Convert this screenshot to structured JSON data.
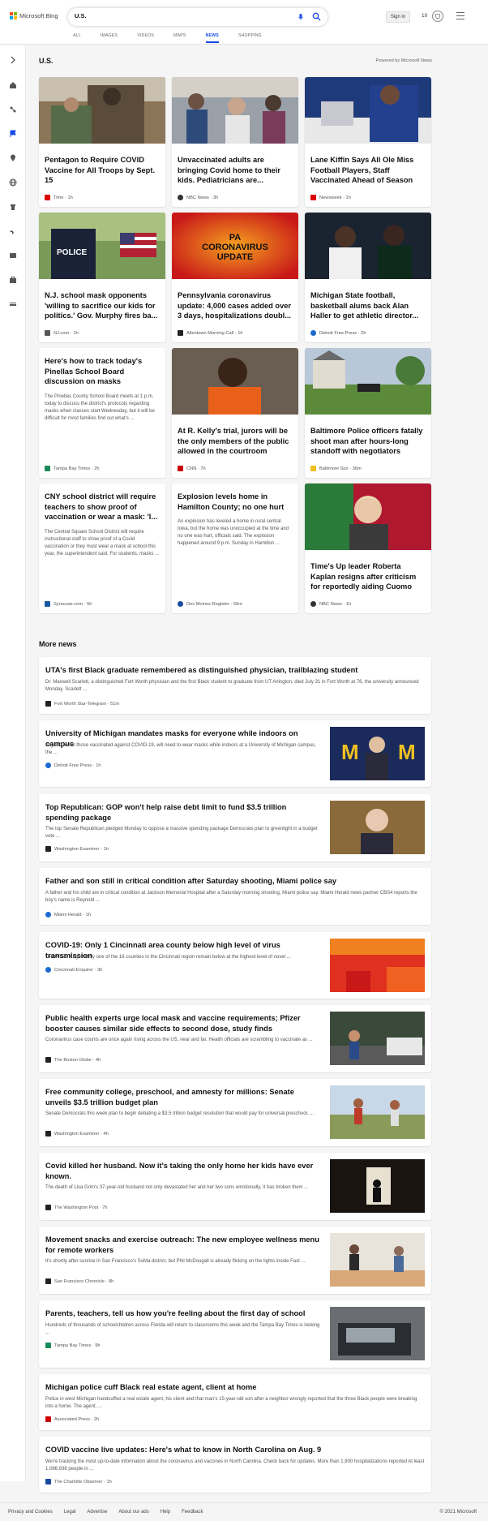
{
  "header": {
    "brand": "Microsoft Bing",
    "search_value": "U.S.",
    "signin_label": "Sign in",
    "rewards_count": "10",
    "tabs": [
      {
        "label": "ALL"
      },
      {
        "label": "IMAGES"
      },
      {
        "label": "VIDEOS"
      },
      {
        "label": "MAPS"
      },
      {
        "label": "NEWS"
      },
      {
        "label": "SHOPPING"
      }
    ],
    "active_tab": "NEWS"
  },
  "main": {
    "section_title": "U.S.",
    "powered_by": "Powered by Microsoft News",
    "cards": [
      {
        "title": "Pentagon to Require COVID Vaccine for All Troops by Sept. 15",
        "desc": "",
        "source": "Time · 1h"
      },
      {
        "title": "Unvaccinated adults are bringing Covid home to their kids. Pediatricians are...",
        "desc": "",
        "source": "NBC News · 3h"
      },
      {
        "title": "Lane Kiffin Says All Ole Miss Football Players, Staff Vaccinated Ahead of Season",
        "desc": "",
        "source": "Newsweek · 1h"
      },
      {
        "title": "N.J. school mask opponents 'willing to sacrifice our kids for politics.' Gov. Murphy fires ba...",
        "desc": "",
        "source": "NJ.com · 1h",
        "image_text": "POLICE"
      },
      {
        "title": "Pennsylvania coronavirus update: 4,000 cases added over 3 days, hospitalizations doubl...",
        "desc": "",
        "source": "Allentown Morning Call · 1h",
        "image_text": "PA\nCORONAVIRUS\nUPDATE"
      },
      {
        "title": "Michigan State football, basketball alums back Alan Haller to get athletic director...",
        "desc": "",
        "source": "Detroit Free Press · 2h"
      },
      {
        "title": "Here's how to track today's Pinellas School Board discussion on masks",
        "desc": "The Pinellas County School Board meets at 1 p.m. today to discuss the district's protocols regarding masks when classes start Wednesday, but it will be difficult for most families find out what's ...",
        "source": "Tampa Bay Times · 2h"
      },
      {
        "title": "At R. Kelly's trial, jurors will be the only members of the public allowed in the courtroom",
        "desc": "",
        "source": "CNN · 7h"
      },
      {
        "title": "Baltimore Police officers fatally shoot man after hours-long standoff with negotiators",
        "desc": "",
        "source": "Baltimore Sun · 36m"
      },
      {
        "title": "CNY school district will require teachers to show proof of vaccination or wear a mask: 'I...",
        "desc": "The Central Square School District will require instructional staff to show proof of a Covid vaccination or they must wear a mask at school this year, the superintendent said. For students, masks ...",
        "source": "Syracuse.com · 5h"
      },
      {
        "title": "Explosion levels home in Hamilton County; no one hurt",
        "desc": "An explosion has leveled a home in rural central Iowa, but the home was unoccupied at the time and no one was hurt, officials said. The explosion happened around 9 p.m. Sunday in Hamilton ...",
        "source": "Des Moines Register · 55m"
      },
      {
        "title": "Time's Up leader Roberta Kaplan resigns after criticism for reportedly aiding Cuomo",
        "desc": "",
        "source": "NBC News · 1h"
      }
    ],
    "more_news_title": "More news",
    "more_news": [
      {
        "title": "UTA's first Black graduate remembered as distinguished physician, trailblazing student",
        "desc": "Dr. Maxwell Scarlett, a distinguished Fort Worth physician and the first Black student to graduate from UT Arlington, died July 31 in Fort Worth at 76, the university announced Monday. Scarlett ...",
        "source": "Fort Worth Star-Telegram · 51m"
      },
      {
        "title": "University of Michigan mandates masks for everyone while indoors on campus",
        "desc": "Anyone, even those vaccinated against COVID-19, will need to wear masks while indoors at a University of Michigan campus, the ...",
        "source": "Detroit Free Press · 1h"
      },
      {
        "title": "Top Republican: GOP won't help raise debt limit to fund $3.5 trillion spending package",
        "desc": "The top Senate Republican pledged Monday to oppose a massive spending package Democrats plan to greenlight in a budget vote ...",
        "source": "Washington Examiner · 1h"
      },
      {
        "title": "Father and son still in critical condition after Saturday shooting, Miami police say",
        "desc": "A father and his child are in critical condition at Jackson Memorial Hospital after a Saturday morning shooting, Miami police say. Miami Herald news partner CBS4 reports the boy's name is Reynold ...",
        "source": "Miami Herald · 1h"
      },
      {
        "title": "COVID-19: Only 1 Cincinnati area county below high level of virus transmission",
        "desc": "UPDATED Aug. 9 Only one of the 16 counties in the Cincinnati region remain below at the highest level of novel ...",
        "source": "Cincinnati Enquirer · 3h"
      },
      {
        "title": "Public health experts urge local mask and vaccine requirements; Pfizer booster causes similar side effects to second dose, study finds",
        "desc": "Coronavirus case counts are once again rising across the US, near and far. Health officials are scrambling to vaccinate as ...",
        "source": "The Boston Globe · 4h"
      },
      {
        "title": "Free community college, preschool, and amnesty for millions: Senate unveils $3.5 trillion budget plan",
        "desc": "Senate Democrats this week plan to begin debating a $3.5 trillion budget resolution that would pay for universal preschool, ...",
        "source": "Washington Examiner · 4h"
      },
      {
        "title": "Covid killed her husband. Now it's taking the only home her kids have ever known.",
        "desc": "The death of Lisa Grim's 37-year-old husband not only devastated her and her two sons emotionally, it has broken them ...",
        "source": "The Washington Post · 7h"
      },
      {
        "title": "Movement snacks and exercise outreach: The new employee wellness menu for remote workers",
        "desc": "It's shortly after sunrise in San Francisco's SoMa district, but Phil McDougall is already flicking on the lights inside Fast ...",
        "source": "San Francisco Chronicle · 8h"
      },
      {
        "title": "Parents, teachers, tell us how you're feeling about the first day of school",
        "desc": "Hundreds of thousands of schoolchildren across Florida will return to classrooms this week and the Tampa Bay Times is looking ...",
        "source": "Tampa Bay Times · 9h"
      },
      {
        "title": "Michigan police cuff Black real estate agent, client at home",
        "desc": "Police in west Michigan handcuffed a real estate agent, his client and that man's 15-year-old son after a neighbor wrongly reported that the three Black people were breaking into a home. The agent, ...",
        "source": "Associated Press · 2h"
      },
      {
        "title": "COVID vaccine live updates: Here's what to know in North Carolina on Aug. 9",
        "desc": "We're tracking the most up-to-date information about the coronavirus and vaccines in North Carolina. Check back for updates. More than 1,900 hospitalizations reported At least 1,086,938 people in ...",
        "source": "The Charlotte Observer · 1h"
      }
    ]
  },
  "footer": {
    "links": [
      "Privacy and Cookies",
      "Legal",
      "Advertise",
      "About our ads",
      "Help",
      "Feedback"
    ],
    "copyright": "© 2021 Microsoft"
  },
  "colors": {
    "accent": "#174ae4",
    "background": "#f5f5f5"
  }
}
